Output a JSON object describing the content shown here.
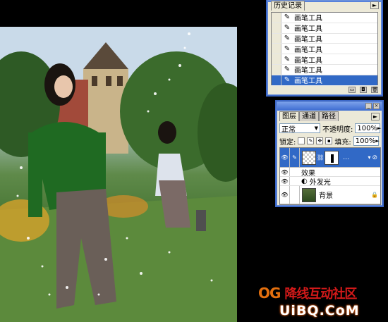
{
  "history": {
    "tab_label": "历史记录",
    "items": [
      {
        "label": "画笔工具"
      },
      {
        "label": "画笔工具"
      },
      {
        "label": "画笔工具"
      },
      {
        "label": "画笔工具"
      },
      {
        "label": "画笔工具"
      },
      {
        "label": "画笔工具"
      },
      {
        "label": "画笔工具",
        "selected": true
      }
    ]
  },
  "layers": {
    "tabs": [
      "图层",
      "通道",
      "路径"
    ],
    "blend_mode": "正常",
    "opacity_label": "不透明度:",
    "opacity_value": "100%",
    "lock_label": "锁定:",
    "fill_label": "填充:",
    "fill_value": "100%",
    "effects_label": "效果",
    "effect_item": "外发光",
    "background_layer": "背景"
  },
  "watermark": {
    "brand_latin": "OG",
    "brand_cn": "降线互动社区",
    "url": "UiBQ.CoM"
  },
  "colors": {
    "selection": "#3169c6",
    "panel_bg": "#ece9d8",
    "accent_blue": "#3c6bd0"
  }
}
